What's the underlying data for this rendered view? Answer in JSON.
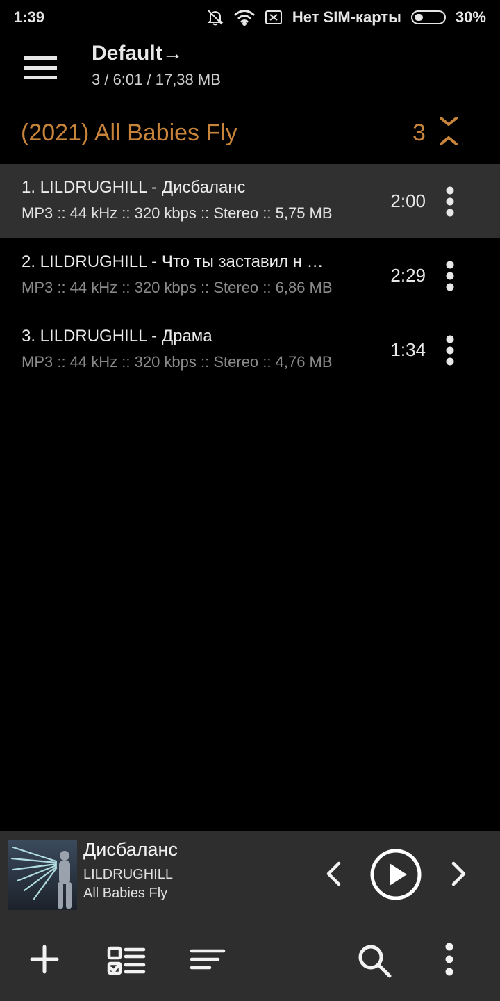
{
  "status_bar": {
    "time": "1:39",
    "carrier": "Нет SIM-карты",
    "battery_percent": "30%",
    "battery_level": 0.3,
    "icons": [
      "bell-off-icon",
      "wifi-icon",
      "sim-off-icon",
      "battery-icon"
    ]
  },
  "header": {
    "title": "Default",
    "title_arrow": "→",
    "summary": "3 / 6:01 / 17,38 MB"
  },
  "album": {
    "title": "(2021) All Babies Fly",
    "count": "3"
  },
  "tracks": [
    {
      "title": "1. LILDRUGHILL - Дисбаланс",
      "meta": "MP3 :: 44 kHz :: 320 kbps :: Stereo :: 5,75 MB",
      "duration": "2:00",
      "active": true
    },
    {
      "title": "2. LILDRUGHILL - Что ты заставил н …",
      "meta": "MP3 :: 44 kHz :: 320 kbps :: Stereo :: 6,86 MB",
      "duration": "2:29",
      "active": false
    },
    {
      "title": "3. LILDRUGHILL - Драма",
      "meta": "MP3 :: 44 kHz :: 320 kbps :: Stereo :: 4,76 MB",
      "duration": "1:34",
      "active": false
    }
  ],
  "now_playing": {
    "title": "Дисбаланс",
    "artist": "LILDRUGHILL",
    "album": "All Babies Fly"
  },
  "bottom_bar": {
    "icons": [
      "add-icon",
      "select-list-icon",
      "sort-icon",
      "search-icon",
      "more-icon"
    ]
  },
  "colors": {
    "accent": "#c8843a",
    "background": "#000000",
    "panel": "#2e2e2e",
    "active_row": "#303030"
  }
}
